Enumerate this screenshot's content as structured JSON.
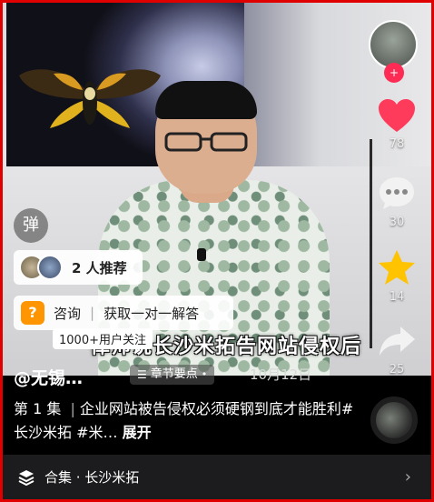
{
  "video": {
    "caption": "律师说长沙米拓告网站侵权后"
  },
  "sidebar": {
    "like_count": "78",
    "comment_count": "30",
    "favorite_count": "14",
    "share_count": "25",
    "follow_symbol": "+"
  },
  "overlays": {
    "danmu_label": "弹",
    "recommend_text": "2 人推荐",
    "consult_label": "咨询",
    "consult_action": "获取一对一解答",
    "follow_tip": "1000+用户关注"
  },
  "post": {
    "author": "@无锡…",
    "chapter_label": "章节要点",
    "date": "10月12日",
    "episode": "第 1 集",
    "description": "企业网站被告侵权必须硬钢到底才能胜利#长沙米拓 #米…",
    "expand_label": "展开"
  },
  "collection": {
    "label": "合集 · 长沙米拓"
  },
  "colors": {
    "accent": "#fe2c55",
    "like": "#ff3b5c",
    "favorite": "#ffc300",
    "consult_icon": "#ff9500",
    "border": "#e00000"
  }
}
